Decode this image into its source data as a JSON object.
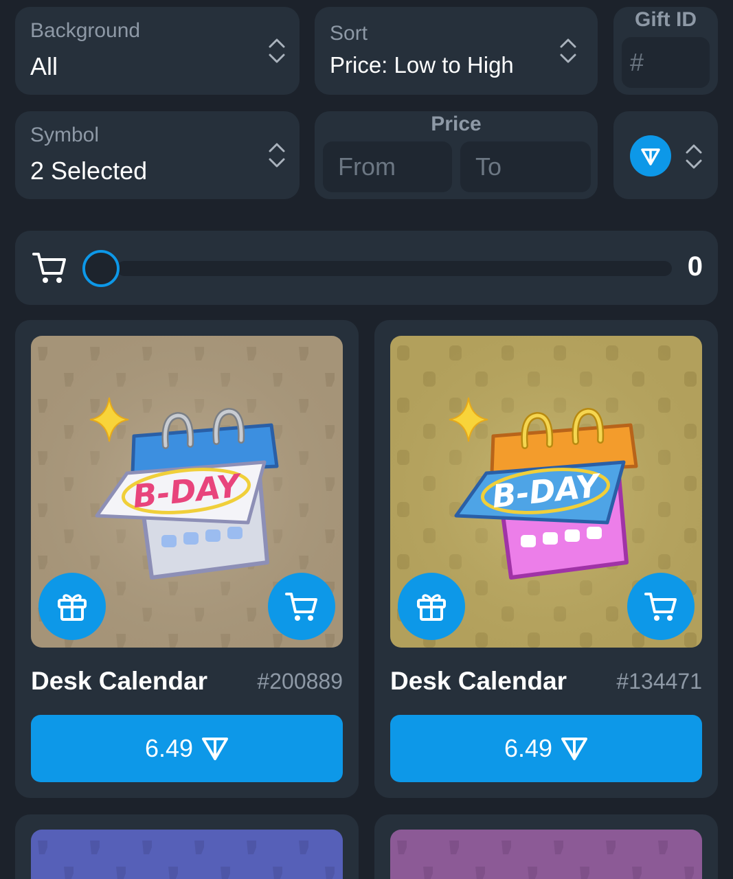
{
  "filters": {
    "background": {
      "label": "Background",
      "value": "All"
    },
    "sort": {
      "label": "Sort",
      "value": "Price: Low to High"
    },
    "gift_id": {
      "label": "Gift ID",
      "placeholder": "#"
    },
    "symbol": {
      "label": "Symbol",
      "value": "2 Selected"
    },
    "price": {
      "label": "Price",
      "from_placeholder": "From",
      "to_placeholder": "To"
    },
    "currency": {
      "icon": "ton-icon"
    }
  },
  "cart": {
    "count": "0",
    "icon": "cart-icon"
  },
  "items": [
    {
      "name": "Desk Calendar",
      "id": "#200889",
      "price": "6.49",
      "image_text": "B-DAY",
      "bg_color": "#a59478",
      "header_color": "#3c8fe0",
      "page_color": "#f4f4f8",
      "base_color": "#d7dbe6",
      "text_color": "#e8447c"
    },
    {
      "name": "Desk Calendar",
      "id": "#134471",
      "price": "6.49",
      "image_text": "B-DAY",
      "bg_color": "#b2a05c",
      "header_color": "#f39c2c",
      "page_color": "#4ea4e6",
      "base_color": "#ec7ee9",
      "text_color": "#ffffff"
    }
  ],
  "colors": {
    "accent": "#0d98e8",
    "panel": "#26303b",
    "background": "#1c222b"
  }
}
